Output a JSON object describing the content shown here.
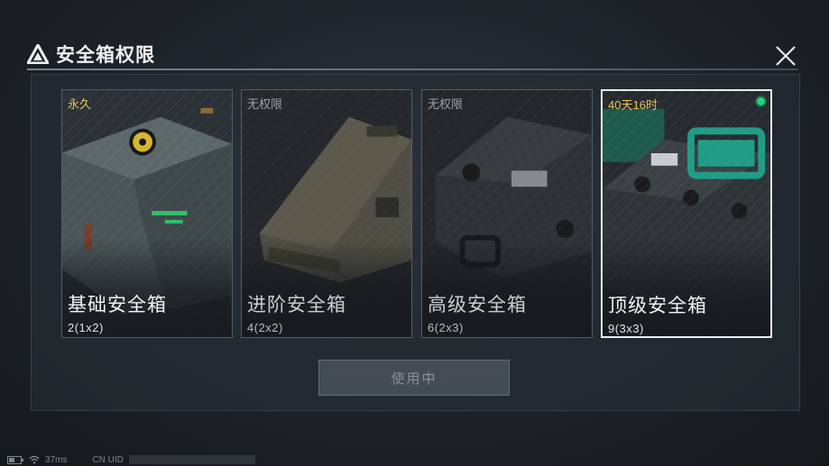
{
  "window": {
    "title": "安全箱权限"
  },
  "cards": [
    {
      "tag": "永久",
      "name": "基础安全箱",
      "size": "2(1x2)"
    },
    {
      "tag": "无权限",
      "name": "进阶安全箱",
      "size": "4(2x2)"
    },
    {
      "tag": "无权限",
      "name": "高级安全箱",
      "size": "6(2x3)"
    },
    {
      "tag": "40天16时",
      "name": "顶级安全箱",
      "size": "9(3x3)"
    }
  ],
  "action": {
    "use_label": "使用中"
  },
  "status": {
    "latency": "37ms",
    "uid_label": "CN UID"
  },
  "colors": {
    "accent_gold": "#e9c45a",
    "active_green": "#22d47a",
    "teal": "#1f9b86"
  }
}
